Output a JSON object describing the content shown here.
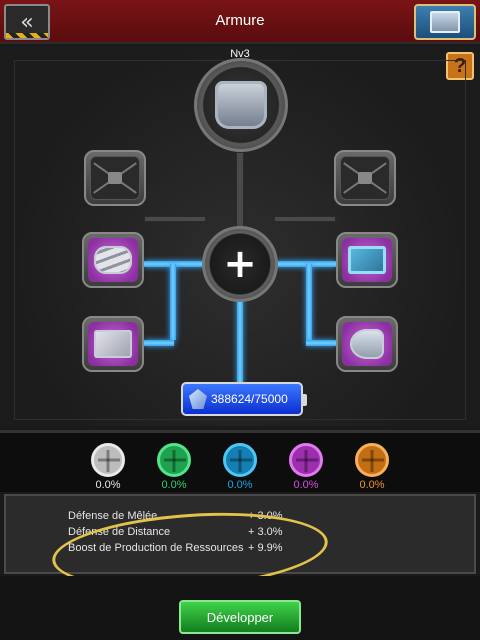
{
  "header": {
    "title": "Armure"
  },
  "help_label": "?",
  "upgrade": {
    "level": "Nv3",
    "center_symbol": "+",
    "energy_value": "388624/75000"
  },
  "slots": [
    {
      "pos": "top-left",
      "state": "locked",
      "icon": "lock-icon"
    },
    {
      "pos": "top-right",
      "state": "locked",
      "icon": "lock-icon"
    },
    {
      "pos": "mid-left",
      "state": "material",
      "icon": "steel-tubes-icon"
    },
    {
      "pos": "mid-right",
      "state": "material",
      "icon": "circuit-board-icon"
    },
    {
      "pos": "bottom-left",
      "state": "material",
      "icon": "steel-plate-icon"
    },
    {
      "pos": "bottom-right",
      "state": "material",
      "icon": "motor-icon"
    }
  ],
  "resources": [
    {
      "color": "#d9d9d9",
      "value": "0.0%"
    },
    {
      "color": "#2fd36b",
      "value": "0.0%"
    },
    {
      "color": "#1fa2e0",
      "value": "0.0%"
    },
    {
      "color": "#d24fe0",
      "value": "0.0%"
    },
    {
      "color": "#f0922a",
      "value": "0.0%"
    }
  ],
  "stats": [
    {
      "label": "Défense de Mêlée",
      "value": "+ 3.0%"
    },
    {
      "label": "Défense de Distance",
      "value": "+ 3.0%"
    },
    {
      "label": "Boost de Production de Ressources",
      "value": "+ 9.9%"
    }
  ],
  "footer": {
    "develop_label": "Développer"
  }
}
